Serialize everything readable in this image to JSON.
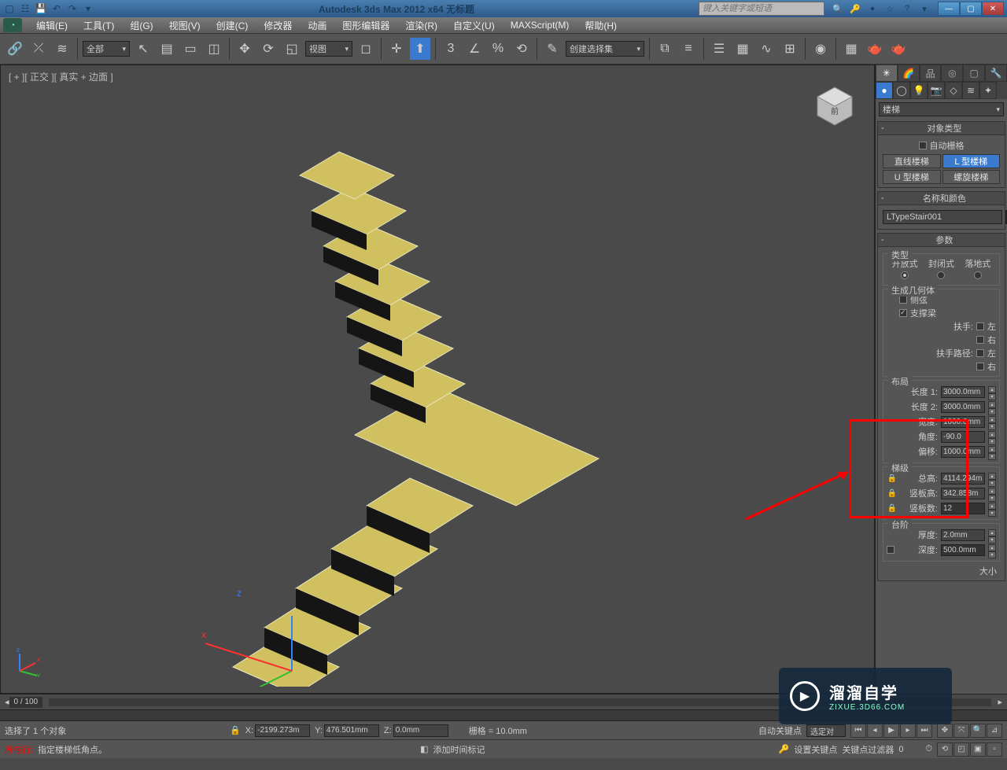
{
  "titlebar": {
    "title": "Autodesk 3ds Max 2012 x64   无标题",
    "search_placeholder": "键入关键字或短语"
  },
  "menus": [
    "编辑(E)",
    "工具(T)",
    "组(G)",
    "视图(V)",
    "创建(C)",
    "修改器",
    "动画",
    "图形编辑器",
    "渲染(R)",
    "自定义(U)",
    "MAXScript(M)",
    "帮助(H)"
  ],
  "toolbar": {
    "filter_combo": "全部",
    "view_combo": "视图",
    "set_combo": "创建选择集"
  },
  "viewport": {
    "label": "[ + ][ 正交 ][ 真实 + 边面 ]"
  },
  "panel": {
    "category": "楼梯",
    "rollouts": {
      "objtype": {
        "title": "对象类型",
        "autogrid": "自动栅格",
        "buttons": [
          "直线楼梯",
          "L 型楼梯",
          "U 型楼梯",
          "螺旋楼梯"
        ],
        "selected": 1
      },
      "namecolor": {
        "title": "名称和颜色",
        "name": "LTypeStair001"
      },
      "params": {
        "title": "参数",
        "type_group": "类型",
        "type_opts": [
          "开放式",
          "封闭式",
          "落地式"
        ],
        "type_sel": 0,
        "geom_group": "生成几何体",
        "geom_checks": {
          "side_string": "侧弦",
          "support": "支撑梁",
          "handrail": "扶手:",
          "left": "左",
          "right": "右",
          "handrail_path": "扶手路径:"
        },
        "layout_group": "布局",
        "layout": {
          "len1_label": "长度 1:",
          "len1": "3000.0mm",
          "len2_label": "长度 2:",
          "len2": "3000.0mm",
          "width_label": "宽度:",
          "width": "1000.0mm",
          "angle_label": "角度:",
          "angle": "-90.0",
          "offset_label": "偏移:",
          "offset": "1000.0mm"
        },
        "stairs_group": "梯级",
        "stairs": {
          "totalh_label": "总高:",
          "totalh": "4114.294m",
          "riserh_label": "竖板高:",
          "riserh": "342.858m",
          "count_label": "竖板数:",
          "count": "12"
        },
        "step_group": "台阶",
        "step": {
          "thick_label": "厚度:",
          "thick": "2.0mm",
          "depth_label": "深度:",
          "depth": "500.0mm"
        }
      }
    }
  },
  "timeline": {
    "frame": "0 / 100"
  },
  "status": {
    "sel": "选择了 1 个对象",
    "hint": "指定楼梯低角点。",
    "x": "-2199.273m",
    "y": "476.501mm",
    "z": "0.0mm",
    "grid": "栅格 = 10.0mm",
    "autokey": "自动关键点",
    "selkey": "选定对",
    "addmarker": "添加时间标记",
    "setkey": "设置关键点",
    "filter": "关键点过滤器",
    "loc": "所在行:",
    "size_label": "大小"
  },
  "watermark": {
    "cn": "溜溜自学",
    "en": "ZIXUE.3D66.COM"
  }
}
